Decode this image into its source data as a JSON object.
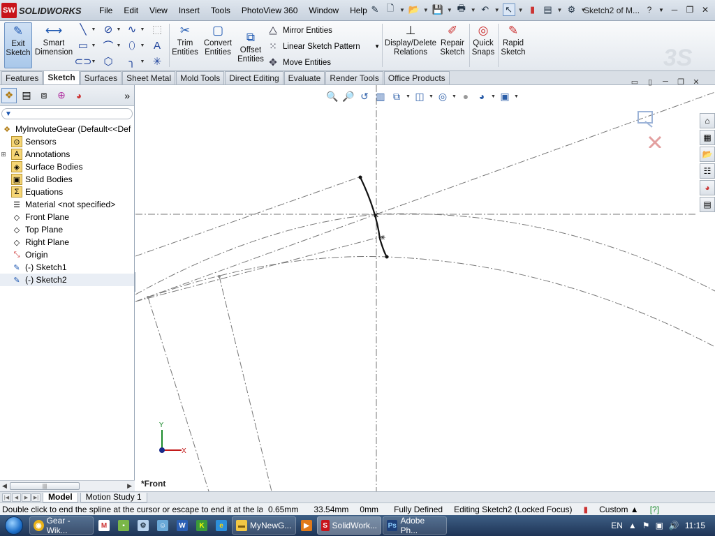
{
  "app": {
    "name": "SOLIDWORKS",
    "logo_mark": "SW",
    "document_title": "Sketch2 of M..."
  },
  "menu": [
    "File",
    "Edit",
    "View",
    "Insert",
    "Tools",
    "PhotoView 360",
    "Window",
    "Help"
  ],
  "ribbon": {
    "exit_sketch": {
      "line1": "Exit",
      "line2": "Sketch"
    },
    "smart_dimension": {
      "line1": "Smart",
      "line2": "Dimension"
    },
    "trim_entities": {
      "line1": "Trim",
      "line2": "Entities"
    },
    "convert_entities": {
      "line1": "Convert",
      "line2": "Entities"
    },
    "offset_entities": {
      "line1": "Offset",
      "line2": "Entities"
    },
    "mirror_entities": "Mirror Entities",
    "linear_sketch_pattern": "Linear Sketch Pattern",
    "move_entities": "Move Entities",
    "display_delete_relations": {
      "line1": "Display/Delete",
      "line2": "Relations"
    },
    "repair_sketch": {
      "line1": "Repair",
      "line2": "Sketch"
    },
    "quick_snaps": {
      "line1": "Quick",
      "line2": "Snaps"
    },
    "rapid_sketch": {
      "line1": "Rapid",
      "line2": "Sketch"
    }
  },
  "command_tabs": [
    {
      "label": "Features",
      "active": false
    },
    {
      "label": "Sketch",
      "active": true
    },
    {
      "label": "Surfaces",
      "active": false
    },
    {
      "label": "Sheet Metal",
      "active": false
    },
    {
      "label": "Mold Tools",
      "active": false
    },
    {
      "label": "Direct Editing",
      "active": false
    },
    {
      "label": "Evaluate",
      "active": false
    },
    {
      "label": "Render Tools",
      "active": false
    },
    {
      "label": "Office Products",
      "active": false
    }
  ],
  "feature_tree": {
    "root": "MyInvoluteGear  (Default<<Def",
    "items": [
      {
        "label": "Sensors",
        "icon": "sensor-icon",
        "expandable": false
      },
      {
        "label": "Annotations",
        "icon": "annotation-icon",
        "expandable": true
      },
      {
        "label": "Surface Bodies",
        "icon": "surface-bodies-icon",
        "expandable": false
      },
      {
        "label": "Solid Bodies",
        "icon": "solid-bodies-icon",
        "expandable": false
      },
      {
        "label": "Equations",
        "icon": "equations-icon",
        "expandable": false
      },
      {
        "label": "Material <not specified>",
        "icon": "material-icon",
        "expandable": false
      },
      {
        "label": "Front Plane",
        "icon": "plane-icon",
        "expandable": false
      },
      {
        "label": "Top Plane",
        "icon": "plane-icon",
        "expandable": false
      },
      {
        "label": "Right Plane",
        "icon": "plane-icon",
        "expandable": false
      },
      {
        "label": "Origin",
        "icon": "origin-icon",
        "expandable": false
      },
      {
        "label": "(-) Sketch1",
        "icon": "sketch-icon",
        "expandable": false
      },
      {
        "label": "(-) Sketch2",
        "icon": "sketch-icon",
        "expandable": false
      }
    ]
  },
  "graphics": {
    "view_label": "*Front",
    "axis_x": "X",
    "axis_y": "Y"
  },
  "bottom_tabs": [
    {
      "label": "Model",
      "active": true
    },
    {
      "label": "Motion Study 1",
      "active": false
    }
  ],
  "status": {
    "message": "Double click to end the spline at the cursor or escape to end it at the last point",
    "x": "0.65mm",
    "y": "33.54mm",
    "z": "0mm",
    "state": "Fully Defined",
    "editing": "Editing Sketch2 (Locked Focus)",
    "units": "Custom"
  },
  "taskbar": {
    "items": [
      {
        "label": "Gear - Wik...",
        "icon": "chrome-icon",
        "color": "#e8b21a"
      },
      {
        "label": "MyNewG...",
        "icon": "folder-icon",
        "color": "#f2c744"
      },
      {
        "label": "SolidWork...",
        "icon": "solidworks-icon",
        "color": "#c8141a"
      },
      {
        "label": "Adobe Ph...",
        "icon": "photoshop-icon",
        "color": "#1c3f7a"
      }
    ],
    "language": "EN",
    "clock": "11:15"
  },
  "colors": {
    "accent": "#c8141a",
    "selection": "#a9c8ea",
    "taskbar": "#1e3456"
  }
}
